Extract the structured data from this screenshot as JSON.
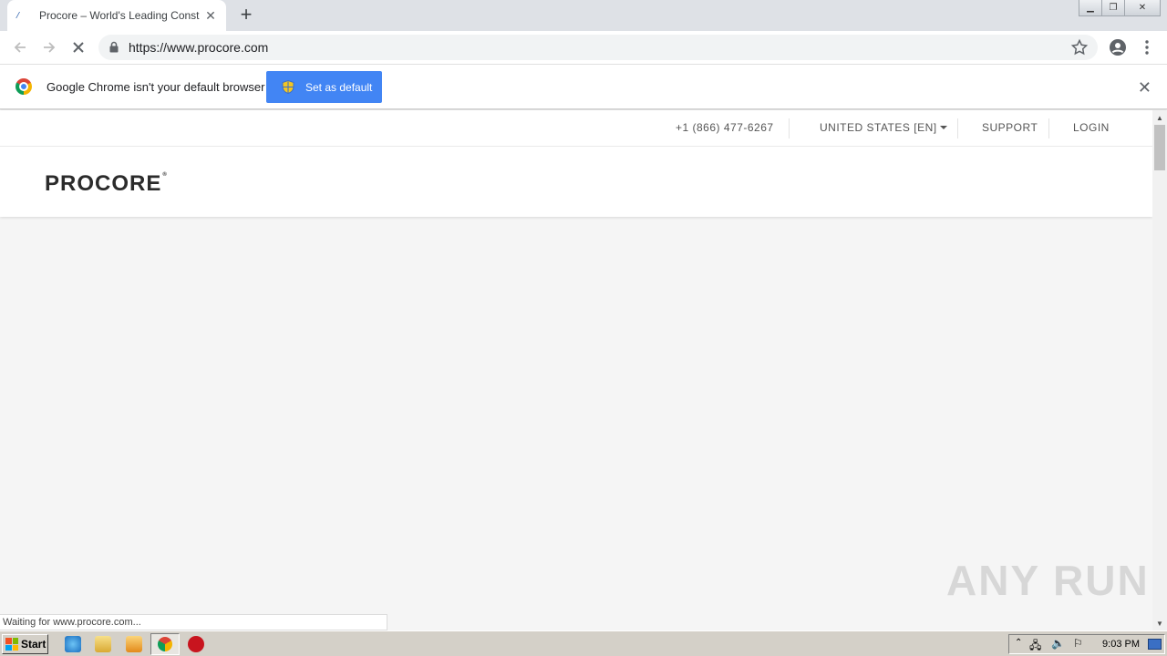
{
  "browser": {
    "tab": {
      "title": "Procore – World's Leading Construct"
    },
    "url": "https://www.procore.com",
    "infobar": {
      "message": "Google Chrome isn't your default browser",
      "button_label": "Set as default"
    },
    "status_text": "Waiting for www.procore.com..."
  },
  "site": {
    "phone": "+1 (866) 477-6267",
    "region": "UNITED STATES [EN]",
    "support": "SUPPORT",
    "login": "LOGIN",
    "logo_text": "PROCORE"
  },
  "watermark": "ANY  RUN",
  "taskbar": {
    "start_label": "Start",
    "clock": "9:03 PM"
  },
  "colors": {
    "chrome_blue": "#4285f4",
    "procore_orange": "#f47e42"
  }
}
